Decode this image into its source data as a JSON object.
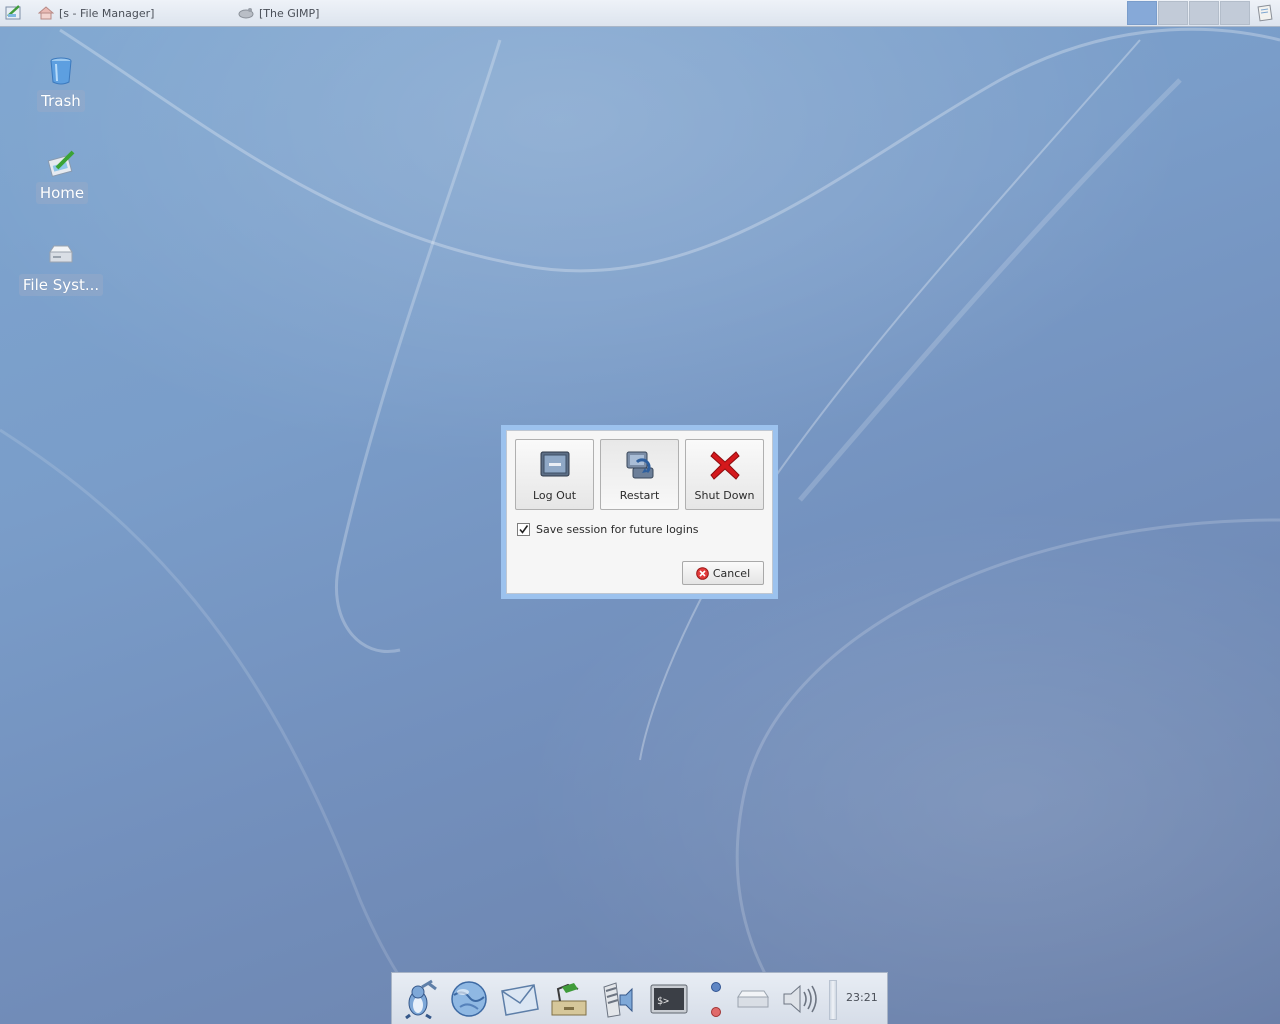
{
  "top_panel": {
    "tasks": [
      {
        "label": "[s - File Manager]",
        "icon": "home-folder-icon"
      },
      {
        "label": "[The GIMP]",
        "icon": "gimp-icon"
      }
    ],
    "workspaces": 4,
    "active_workspace": 1
  },
  "desktop": {
    "icons": [
      {
        "label": "Trash",
        "icon": "trash-icon"
      },
      {
        "label": "Home",
        "icon": "home-icon"
      },
      {
        "label": "File Syst...",
        "icon": "drive-icon"
      }
    ]
  },
  "logout_dialog": {
    "buttons": [
      {
        "label": "Log Out",
        "icon": "logout-icon"
      },
      {
        "label": "Restart",
        "icon": "restart-icon"
      },
      {
        "label": "Shut Down",
        "icon": "shutdown-icon"
      }
    ],
    "save_session": {
      "label": "Save session for future logins",
      "checked": true
    },
    "cancel_label": "Cancel"
  },
  "dock": {
    "launchers": [
      "xfce-menu-icon",
      "web-browser-icon",
      "mail-icon",
      "file-manager-icon",
      "media-player-icon",
      "terminal-icon"
    ],
    "tray": [
      "lock-icon",
      "logout-tray-icon",
      "removable-drive-icon",
      "volume-icon"
    ],
    "clock": "23:21"
  },
  "colors": {
    "dialog_border": "#9cc2ee",
    "active_workspace": "#86a9d8",
    "shutdown_red": "#d4181c"
  }
}
